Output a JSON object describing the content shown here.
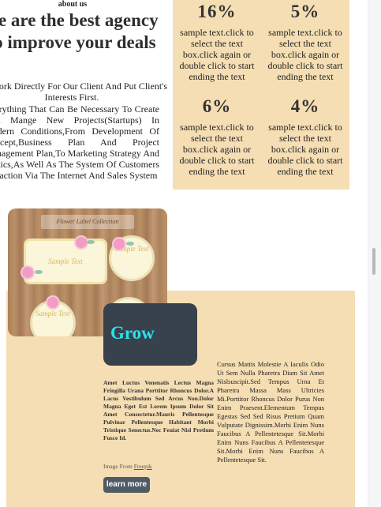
{
  "about": {
    "label": "about us"
  },
  "headline": "we are the best agency to improve your deals",
  "lead": "We Work Directly For Our Client And Put Client's Interests First.",
  "body": "Everything That Can Be Necessary To Create And Mange New Projects(Startups) In Modern Conditions,From Development Of Concept,Business Plan And Project Management Plan,To Marketing Strategy And Tactics,As Well As The System Of Customers Attraction Via The Internet And Sales System",
  "stats": [
    {
      "value": "16%",
      "text": "sample text.click to select the text box.click again or double click to start ending the text"
    },
    {
      "value": "5%",
      "text": "sample text.click to select the text box.click again or double click to start ending the text"
    },
    {
      "value": "6%",
      "text": "sample text.click to select the text box.click again or double click to start ending the text"
    },
    {
      "value": "4%",
      "text": "sample text.click to select the text box.click again or double click to start ending the text"
    }
  ],
  "flower_image": {
    "banner": "Flower Label Collection",
    "label_rect": "Sample Text",
    "label_circle_1": "Sample Text",
    "label_circle_2": "Sample Text"
  },
  "grow": {
    "title": "Grow",
    "text": "Amet Luctus Venenatis Lectus Magna Fringilla Urana Porttitor Rhoncus Dolor.A Lacus Vestibulum Sed Arcus Non.Dolor Magna Eget Est Lorem Ipsum Dolor Sit Amet Consectetur.Mauris Pellentesque Pulvinar Pellentesque Habitant Morbi Tristique Senectus.Nec Feuiat Nisl Pretium Fusce Id.",
    "credit_prefix": "Image From",
    "credit_link": "Freepik",
    "button": "learn more"
  },
  "right_text": "Cursus Mattis Molestie A Iaculis Odio Ut Sem Nulla Pharetra Diam Sit Amet Nislsuscipit.Sed Tempus Urna Et Pharetra Massa Mass Ultricies Mi.Porttitor Rhoncus Dolor Purus Non Enim Praesent.Elementum Tempus Egestas Sed Sed Risus Pretium Quam Vulputate Dignissim.Morbi Enim Nuns Faucibus A Pellentetesque Sit.Morbi Enim Nuns Faucibus A Pellentetesque Sit.Morbi Enim Nuns Faucibus A Pellentetesque Sit."
}
